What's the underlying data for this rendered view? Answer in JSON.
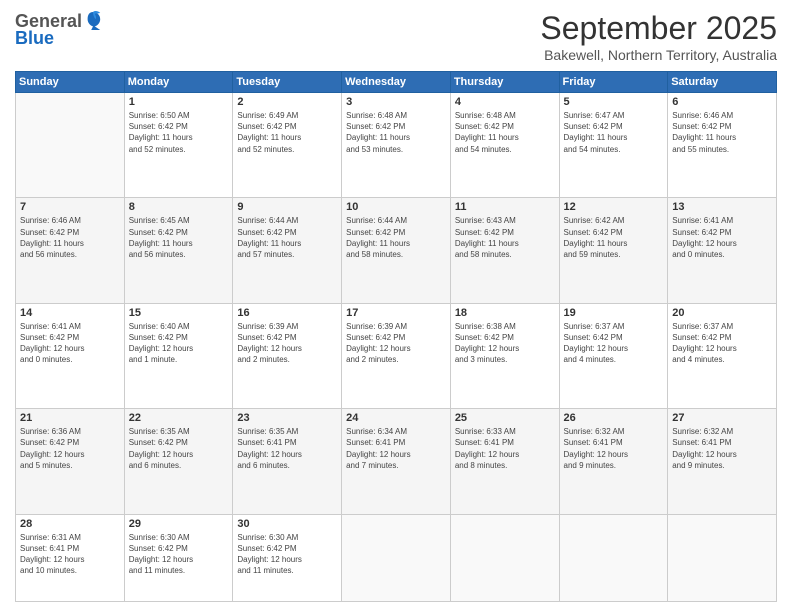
{
  "logo": {
    "general": "General",
    "blue": "Blue"
  },
  "title": "September 2025",
  "location": "Bakewell, Northern Territory, Australia",
  "weekdays": [
    "Sunday",
    "Monday",
    "Tuesday",
    "Wednesday",
    "Thursday",
    "Friday",
    "Saturday"
  ],
  "weeks": [
    [
      {
        "day": "",
        "info": ""
      },
      {
        "day": "1",
        "info": "Sunrise: 6:50 AM\nSunset: 6:42 PM\nDaylight: 11 hours\nand 52 minutes."
      },
      {
        "day": "2",
        "info": "Sunrise: 6:49 AM\nSunset: 6:42 PM\nDaylight: 11 hours\nand 52 minutes."
      },
      {
        "day": "3",
        "info": "Sunrise: 6:48 AM\nSunset: 6:42 PM\nDaylight: 11 hours\nand 53 minutes."
      },
      {
        "day": "4",
        "info": "Sunrise: 6:48 AM\nSunset: 6:42 PM\nDaylight: 11 hours\nand 54 minutes."
      },
      {
        "day": "5",
        "info": "Sunrise: 6:47 AM\nSunset: 6:42 PM\nDaylight: 11 hours\nand 54 minutes."
      },
      {
        "day": "6",
        "info": "Sunrise: 6:46 AM\nSunset: 6:42 PM\nDaylight: 11 hours\nand 55 minutes."
      }
    ],
    [
      {
        "day": "7",
        "info": "Sunrise: 6:46 AM\nSunset: 6:42 PM\nDaylight: 11 hours\nand 56 minutes."
      },
      {
        "day": "8",
        "info": "Sunrise: 6:45 AM\nSunset: 6:42 PM\nDaylight: 11 hours\nand 56 minutes."
      },
      {
        "day": "9",
        "info": "Sunrise: 6:44 AM\nSunset: 6:42 PM\nDaylight: 11 hours\nand 57 minutes."
      },
      {
        "day": "10",
        "info": "Sunrise: 6:44 AM\nSunset: 6:42 PM\nDaylight: 11 hours\nand 58 minutes."
      },
      {
        "day": "11",
        "info": "Sunrise: 6:43 AM\nSunset: 6:42 PM\nDaylight: 11 hours\nand 58 minutes."
      },
      {
        "day": "12",
        "info": "Sunrise: 6:42 AM\nSunset: 6:42 PM\nDaylight: 11 hours\nand 59 minutes."
      },
      {
        "day": "13",
        "info": "Sunrise: 6:41 AM\nSunset: 6:42 PM\nDaylight: 12 hours\nand 0 minutes."
      }
    ],
    [
      {
        "day": "14",
        "info": "Sunrise: 6:41 AM\nSunset: 6:42 PM\nDaylight: 12 hours\nand 0 minutes."
      },
      {
        "day": "15",
        "info": "Sunrise: 6:40 AM\nSunset: 6:42 PM\nDaylight: 12 hours\nand 1 minute."
      },
      {
        "day": "16",
        "info": "Sunrise: 6:39 AM\nSunset: 6:42 PM\nDaylight: 12 hours\nand 2 minutes."
      },
      {
        "day": "17",
        "info": "Sunrise: 6:39 AM\nSunset: 6:42 PM\nDaylight: 12 hours\nand 2 minutes."
      },
      {
        "day": "18",
        "info": "Sunrise: 6:38 AM\nSunset: 6:42 PM\nDaylight: 12 hours\nand 3 minutes."
      },
      {
        "day": "19",
        "info": "Sunrise: 6:37 AM\nSunset: 6:42 PM\nDaylight: 12 hours\nand 4 minutes."
      },
      {
        "day": "20",
        "info": "Sunrise: 6:37 AM\nSunset: 6:42 PM\nDaylight: 12 hours\nand 4 minutes."
      }
    ],
    [
      {
        "day": "21",
        "info": "Sunrise: 6:36 AM\nSunset: 6:42 PM\nDaylight: 12 hours\nand 5 minutes."
      },
      {
        "day": "22",
        "info": "Sunrise: 6:35 AM\nSunset: 6:42 PM\nDaylight: 12 hours\nand 6 minutes."
      },
      {
        "day": "23",
        "info": "Sunrise: 6:35 AM\nSunset: 6:41 PM\nDaylight: 12 hours\nand 6 minutes."
      },
      {
        "day": "24",
        "info": "Sunrise: 6:34 AM\nSunset: 6:41 PM\nDaylight: 12 hours\nand 7 minutes."
      },
      {
        "day": "25",
        "info": "Sunrise: 6:33 AM\nSunset: 6:41 PM\nDaylight: 12 hours\nand 8 minutes."
      },
      {
        "day": "26",
        "info": "Sunrise: 6:32 AM\nSunset: 6:41 PM\nDaylight: 12 hours\nand 9 minutes."
      },
      {
        "day": "27",
        "info": "Sunrise: 6:32 AM\nSunset: 6:41 PM\nDaylight: 12 hours\nand 9 minutes."
      }
    ],
    [
      {
        "day": "28",
        "info": "Sunrise: 6:31 AM\nSunset: 6:41 PM\nDaylight: 12 hours\nand 10 minutes."
      },
      {
        "day": "29",
        "info": "Sunrise: 6:30 AM\nSunset: 6:42 PM\nDaylight: 12 hours\nand 11 minutes."
      },
      {
        "day": "30",
        "info": "Sunrise: 6:30 AM\nSunset: 6:42 PM\nDaylight: 12 hours\nand 11 minutes."
      },
      {
        "day": "",
        "info": ""
      },
      {
        "day": "",
        "info": ""
      },
      {
        "day": "",
        "info": ""
      },
      {
        "day": "",
        "info": ""
      }
    ]
  ]
}
